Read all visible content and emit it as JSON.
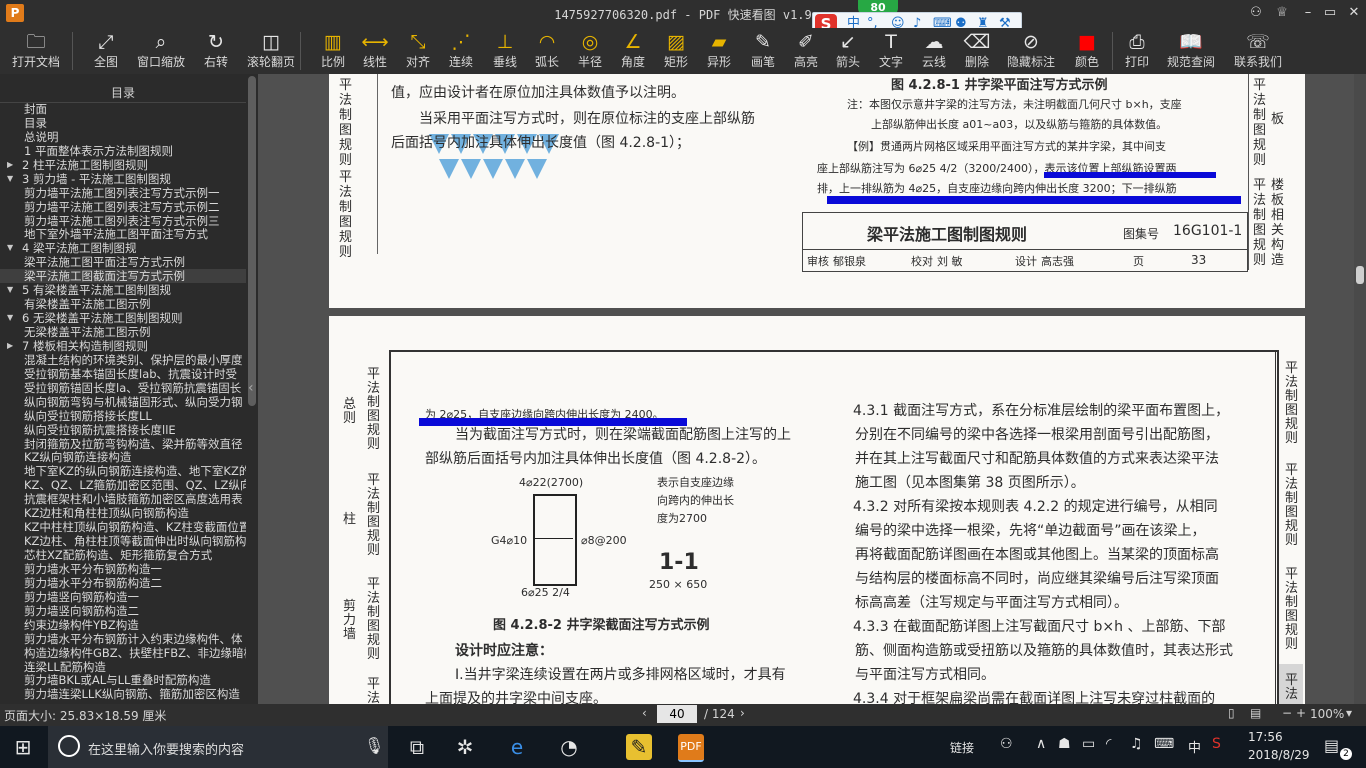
{
  "window": {
    "title": "1475927706320.pdf - PDF 快速看图 v1.9",
    "logo": "P"
  },
  "ime": {
    "logo": "S",
    "mode": "中",
    "punct": "°,",
    "badge_count": "80"
  },
  "toolbar": {
    "items": [
      {
        "label": "打开文档",
        "icon": "folder-icon",
        "glyph": "🗀"
      },
      {
        "label": "全图",
        "icon": "fit-all-icon",
        "glyph": "⤢"
      },
      {
        "label": "窗口缩放",
        "icon": "zoom-window-icon",
        "glyph": "⌕"
      },
      {
        "label": "右转",
        "icon": "rotate-right-icon",
        "glyph": "↻"
      },
      {
        "label": "滚轮翻页",
        "icon": "mouse-wheel-icon",
        "glyph": "◫"
      },
      {
        "label": "比例",
        "icon": "scale-icon",
        "glyph": "▥"
      },
      {
        "label": "线性",
        "icon": "linear-measure-icon",
        "glyph": "⟷"
      },
      {
        "label": "对齐",
        "icon": "align-measure-icon",
        "glyph": "⤡"
      },
      {
        "label": "连续",
        "icon": "continuous-measure-icon",
        "glyph": "⋰"
      },
      {
        "label": "垂线",
        "icon": "perpendicular-icon",
        "glyph": "⊥"
      },
      {
        "label": "弧长",
        "icon": "arc-length-icon",
        "glyph": "◠"
      },
      {
        "label": "半径",
        "icon": "radius-icon",
        "glyph": "◎"
      },
      {
        "label": "角度",
        "icon": "angle-icon",
        "glyph": "∠"
      },
      {
        "label": "矩形",
        "icon": "rectangle-area-icon",
        "glyph": "▨"
      },
      {
        "label": "异形",
        "icon": "polygon-area-icon",
        "glyph": "▰"
      },
      {
        "label": "画笔",
        "icon": "pen-icon",
        "glyph": "✎"
      },
      {
        "label": "高亮",
        "icon": "highlighter-icon",
        "glyph": "✐"
      },
      {
        "label": "箭头",
        "icon": "arrow-icon",
        "glyph": "↙"
      },
      {
        "label": "文字",
        "icon": "text-icon",
        "glyph": "T"
      },
      {
        "label": "云线",
        "icon": "cloud-line-icon",
        "glyph": "☁"
      },
      {
        "label": "删除",
        "icon": "eraser-icon",
        "glyph": "⌫"
      },
      {
        "label": "隐藏标注",
        "icon": "hide-annotation-icon",
        "glyph": "⊘"
      },
      {
        "label": "颜色",
        "icon": "color-swatch-icon",
        "glyph": "■"
      },
      {
        "label": "打印",
        "icon": "printer-icon",
        "glyph": "⎙"
      },
      {
        "label": "规范查阅",
        "icon": "book-icon",
        "glyph": "📖"
      },
      {
        "label": "联系我们",
        "icon": "support-icon",
        "glyph": "☏"
      }
    ],
    "color_value": "#ff0000"
  },
  "sidebar": {
    "header": "目录",
    "items": [
      {
        "label": "封面",
        "level": 1
      },
      {
        "label": "目录",
        "level": 1
      },
      {
        "label": "总说明",
        "level": 1
      },
      {
        "label": "1 平面整体表示方法制图规则",
        "level": 1
      },
      {
        "label": "2 柱平法施工图制图规则",
        "level": 0,
        "arrow": "▶"
      },
      {
        "label": "3 剪力墙 - 平法施工图制图规",
        "level": 0,
        "arrow": "▼"
      },
      {
        "label": "剪力墙平法施工图列表注写方式示例一",
        "level": 1
      },
      {
        "label": "剪力墙平法施工图列表注写方式示例二",
        "level": 1
      },
      {
        "label": "剪力墙平法施工图列表注写方式示例三",
        "level": 1
      },
      {
        "label": "地下室外墙平法施工图平面注写方式",
        "level": 1
      },
      {
        "label": "4 梁平法施工图制图规",
        "level": 0,
        "arrow": "▼"
      },
      {
        "label": "梁平法施工图平面注写方式示例",
        "level": 1
      },
      {
        "label": "梁平法施工图截面注写方式示例",
        "level": 1,
        "selected": true
      },
      {
        "label": "5 有梁楼盖平法施工图制图规",
        "level": 0,
        "arrow": "▼"
      },
      {
        "label": "有梁楼盖平法施工图示例",
        "level": 1
      },
      {
        "label": "6 无梁楼盖平法施工图制图规则",
        "level": 0,
        "arrow": "▼"
      },
      {
        "label": "无梁楼盖平法施工图示例",
        "level": 1
      },
      {
        "label": "7 楼板相关构造制图规则",
        "level": 0,
        "arrow": "▶"
      },
      {
        "label": "混凝土结构的环境类别、保护层的最小厚度",
        "level": 1
      },
      {
        "label": "受拉钢筋基本锚固长度lab、抗震设计时受",
        "level": 1
      },
      {
        "label": "受拉钢筋锚固长度la、受拉钢筋抗震锚固长",
        "level": 1
      },
      {
        "label": "纵向钢筋弯钩与机械锚固形式、纵向受力钢",
        "level": 1
      },
      {
        "label": "纵向受拉钢筋搭接长度LL",
        "level": 1
      },
      {
        "label": "纵向受拉钢筋抗震搭接长度llE",
        "level": 1
      },
      {
        "label": "封闭箍筋及拉筋弯钩构造、梁并筋等效直径",
        "level": 1
      },
      {
        "label": "KZ纵向钢筋连接构造",
        "level": 1
      },
      {
        "label": "地下室KZ的纵向钢筋连接构造、地下室KZ的",
        "level": 1
      },
      {
        "label": "KZ、QZ、LZ箍筋加密区范围、QZ、LZ纵向钢",
        "level": 1
      },
      {
        "label": "抗震框架柱和小墙肢箍筋加密区高度选用表",
        "level": 1
      },
      {
        "label": "KZ边柱和角柱柱顶纵向钢筋构造",
        "level": 1
      },
      {
        "label": "KZ中柱柱顶纵向钢筋构造、KZ柱变截面位置",
        "level": 1
      },
      {
        "label": "KZ边柱、角柱柱顶等截面伸出时纵向钢筋构",
        "level": 1
      },
      {
        "label": "芯柱XZ配筋构造、矩形箍筋复合方式",
        "level": 1
      },
      {
        "label": "剪力墙水平分布钢筋构造一",
        "level": 1
      },
      {
        "label": "剪力墙水平分布钢筋构造二",
        "level": 1
      },
      {
        "label": "剪力墙竖向钢筋构造一",
        "level": 1
      },
      {
        "label": "剪力墙竖向钢筋构造二",
        "level": 1
      },
      {
        "label": "约束边缘构件YBZ构造",
        "level": 1
      },
      {
        "label": "剪力墙水平分布钢筋计入约束边缘构件、体",
        "level": 1
      },
      {
        "label": "构造边缘构件GBZ、扶壁柱FBZ、非边缘暗柱",
        "level": 1
      },
      {
        "label": "连梁LL配筋构造",
        "level": 1
      },
      {
        "label": "剪力墙BKL或AL与LL重叠时配筋构造",
        "level": 1
      },
      {
        "label": "剪力墙连梁LLK纵向钢筋、箍筋加密区构造",
        "level": 1
      }
    ]
  },
  "page1": {
    "side_tabs": [
      "平法制图规则",
      "平法制图规则"
    ],
    "para1": "值，应由设计者在原位加注具体数值予以注明。",
    "para2a": "当采用平面注写方式时，则在原位标注的支座上部纵筋",
    "para2b": "后面括号内加注具体伸出长度值（图 4.2.8-1）；",
    "fig_title": "图 4.2.8-1  井字梁平面注写方式示例",
    "note1": "注：本图仅示意井字梁的注写方法，未注明截面几何尺寸 b×h，支座",
    "note2": "上部纵筋伸出长度 a01~a03，以及纵筋与箍筋的具体数值。",
    "ex1": "【例】贯通两片网格区域采用平面注写方式的某井字梁，其中间支",
    "ex2": "座上部纵筋注写为 6⌀25 4/2（3200/2400），表示该位置上部纵筋设置两",
    "ex3": "排，上一排纵筋为 4⌀25，自支座边缘向跨内伸出长度 3200；下一排纵筋",
    "title_block": {
      "title": "梁平法施工图制图规则",
      "atlas_label": "图集号",
      "atlas": "16G101-1",
      "row": [
        "审核",
        "郁银泉",
        "校对",
        "刘 敏",
        "设计",
        "高志强",
        "页"
      ],
      "page_no": "33"
    },
    "right_tabs": [
      "平法制图规则",
      "板",
      "平法制图规则",
      "楼板相关构造"
    ]
  },
  "page2": {
    "left_tabs": [
      "平法制图规则",
      "总则",
      "平法制图规则",
      "柱",
      "平法制图规则",
      "剪力墙",
      "平法"
    ],
    "hl_text": "为 2⌀25，自支座边缘向跨内伸出长度为 2400。",
    "para1": "当为截面注写方式时，则在梁端截面配筋图上注写的上",
    "para2": "部纵筋后面括号内加注具体伸出长度值（图 4.2.8-2）。",
    "fig": {
      "top_rebar": "4⌀22(2700)",
      "stirrup": "⌀8@200",
      "side": "G4⌀10",
      "bottom": "6⌀25  2/4",
      "callout1": "表示自支座边缘",
      "callout2": "向跨内的伸出长",
      "callout3": "度为2700",
      "section": "1-1",
      "size": "250 × 650"
    },
    "fig_title": "图 4.2.8-2   井字梁截面注写方式示例",
    "design_head": "设计时应注意：",
    "item1a": "Ⅰ.当井字梁连续设置在两片或多排网格区域时，才具有",
    "item1b": "上面提及的井字梁中间支座。",
    "right_col": [
      "4.3.1  截面注写方式，系在分标准层绘制的梁平面布置图上，",
      "分别在不同编号的梁中各选择一根梁用剖面号引出配筋图，",
      "并在其上注写截面尺寸和配筋具体数值的方式来表达梁平法",
      "施工图（见本图集第 38 页图所示）。",
      "4.3.2  对所有梁按本规则表 4.2.2 的规定进行编号，从相同",
      "编号的梁中选择一根梁，先将“单边截面号”画在该梁上，",
      "再将截面配筋详图画在本图或其他图上。当某梁的顶面标高",
      "与结构层的楼面标高不同时，尚应继其梁编号后注写梁顶面",
      "标高高差（注写规定与平面注写方式相同）。",
      "4.3.3  在截面配筋详图上注写截面尺寸 b×h 、上部筋、下部",
      "筋、侧面构造筋或受扭筋以及箍筋的具体数值时，其表达形式",
      "与平面注写方式相同。",
      "4.3.4  对于框架扁梁尚需在截面详图上注写未穿过柱截面的"
    ],
    "right_tabs": [
      "平法制图规则",
      "平法制图规则",
      "平法制图规则",
      "平法"
    ]
  },
  "status": {
    "page_size": "页面大小: 25.83×18.59 厘米",
    "page_current": "40",
    "page_total": "/ 124",
    "zoom": "100%"
  },
  "taskbar": {
    "search_placeholder": "在这里输入你要搜索的内容",
    "tray_link": "链接",
    "ime": "中",
    "time": "17:56",
    "date": "2018/8/29",
    "notify_count": "2"
  },
  "colors": {
    "highlight": "#0a0ad8",
    "accent": "#e07b1a"
  }
}
